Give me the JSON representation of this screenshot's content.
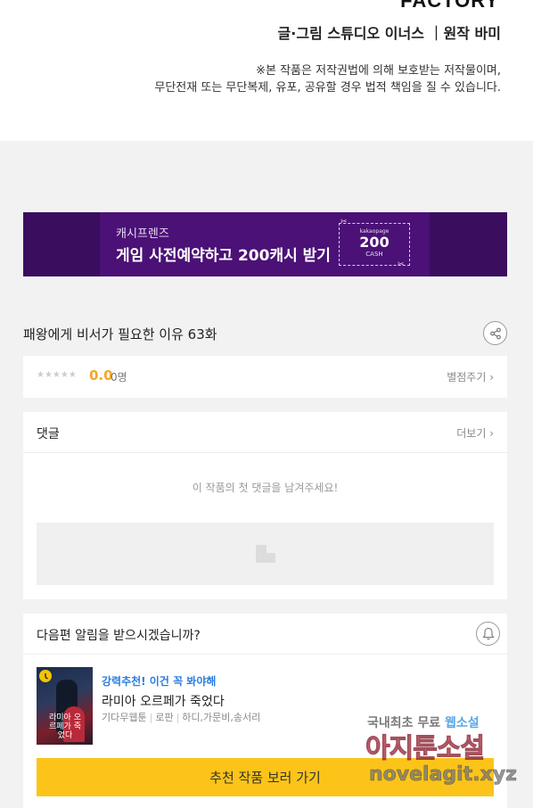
{
  "header": {
    "studio_wordmark": "FACTORY",
    "credits": "글·그림 스튜디오 이너스  ｜원작 바미",
    "copyright_line1": "※본 작품은 저작권법에 의해 보호받는 저작물이며,",
    "copyright_line2": "무단전재 또는 무단복제, 유포, 공유할 경우 법적 책임을 질 수 있습니다."
  },
  "banner": {
    "subtitle": "캐시프렌즈",
    "headline": "게임 사전예약하고 200캐시 받기",
    "coupon_brand": "kakaopage",
    "coupon_amount": "200",
    "coupon_unit": "CASH",
    "colors": {
      "background": "#3a0d5e",
      "panel": "#4b1176"
    }
  },
  "episode": {
    "title": "패왕에게 비서가 필요한 이유 63화",
    "share_icon": "share-icon"
  },
  "rating": {
    "stars": "★★★★★",
    "score": "0.0",
    "count": "0명",
    "rate_link": "별점주기 ›"
  },
  "comments": {
    "heading": "댓글",
    "more_link": "더보기 ›",
    "empty_message": "이 작품의 첫 댓글을 남겨주세요!"
  },
  "notify": {
    "question": "다음편 알림을 받으시겠습니까?",
    "bell_icon": "bell-icon"
  },
  "recommendation": {
    "promo": "강력추천! 이건 꼭 봐야해",
    "title": "라미아 오르페가 죽었다",
    "meta": [
      "기다무웹툰",
      "로판",
      "하디,가문비,송서리"
    ],
    "cover_text": "라미아 오르페가 죽었다",
    "cta_label": "추천 작품 보러 가기",
    "colors": {
      "promo": "#2a7de1",
      "cta": "#fcc419",
      "score": "#f5a623"
    }
  },
  "watermark": {
    "line1_prefix": "국내최초 무료 ",
    "line1_highlight": "웹소설",
    "line2": "아지툰소설",
    "line3": "novelagit.xyz"
  }
}
